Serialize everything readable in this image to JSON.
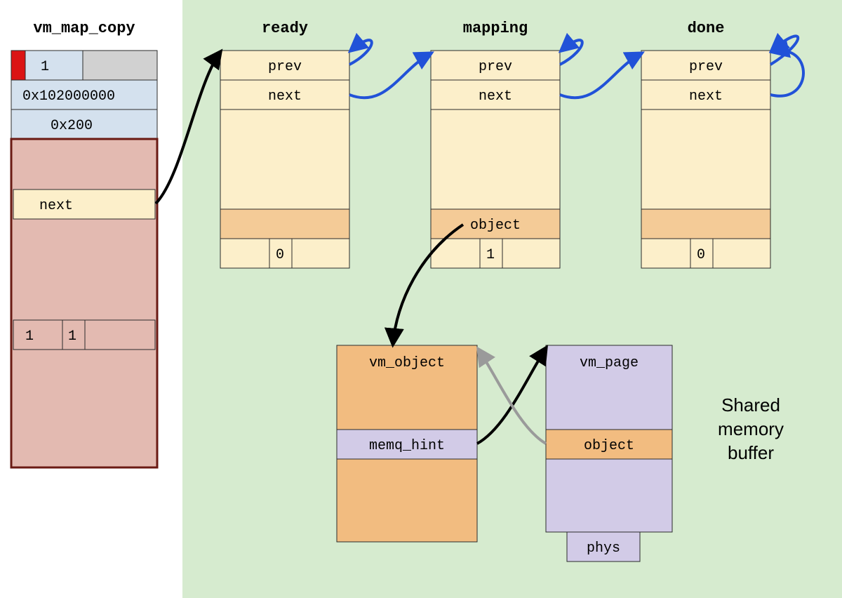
{
  "vm_map_copy": {
    "title": "vm_map_copy",
    "cell1": "1",
    "addr": "0x102000000",
    "size": "0x200",
    "next": "next",
    "b1": "1",
    "b2": "1"
  },
  "entries": {
    "ready": {
      "title": "ready",
      "prev": "prev",
      "next": "next",
      "object": "",
      "flag": "0"
    },
    "mapping": {
      "title": "mapping",
      "prev": "prev",
      "next": "next",
      "object": "object",
      "flag": "1"
    },
    "done": {
      "title": "done",
      "prev": "prev",
      "next": "next",
      "object": "",
      "flag": "0"
    }
  },
  "vm_object": {
    "title": "vm_object",
    "memq": "memq_hint"
  },
  "vm_page": {
    "title": "vm_page",
    "object": "object",
    "phys": "phys"
  },
  "caption": {
    "l1": "Shared",
    "l2": "memory",
    "l3": "buffer"
  },
  "colors": {
    "green_bg": "#d6ebcf",
    "entry_fill": "#fcefca",
    "entry_dark": "#f4cb97",
    "blue_fill": "#d4e1ee",
    "grey_fill": "#d1d1d1",
    "red_fill": "#db1414",
    "pink_fill": "#e3bab1",
    "pink_border": "#6a1a13",
    "orange_fill": "#f2bc80",
    "lavender_fill": "#d2cbe7",
    "stroke": "#2b2b2b",
    "blue_arrow": "#2152d8",
    "grey_arrow": "#9a9a9a"
  }
}
